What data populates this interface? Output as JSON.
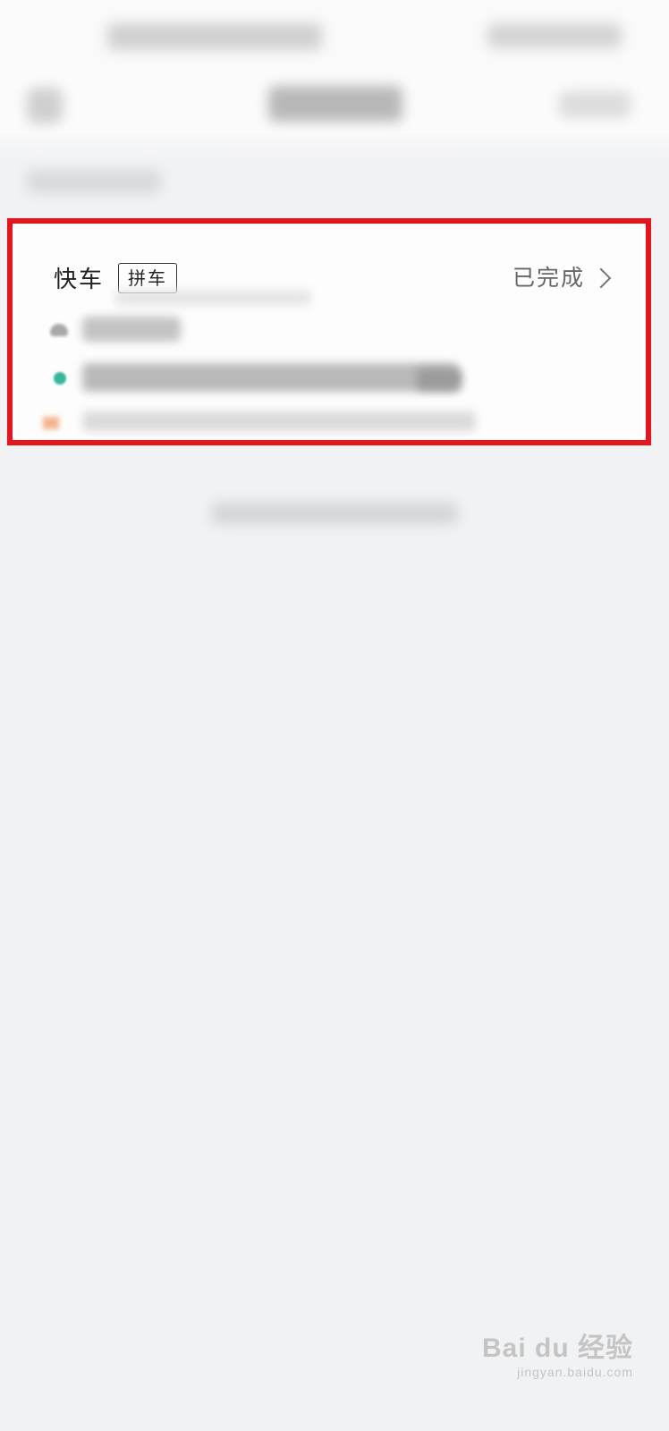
{
  "order_card": {
    "service_type": "快车",
    "ride_tag": "拼车",
    "status": "已完成"
  },
  "watermark": {
    "logo": "Bai du 经验",
    "sub": "jingyan.baidu.com"
  },
  "colors": {
    "highlight_border": "#e8141c",
    "pickup_dot": "#a8a8a8",
    "destination_dot": "#35b89a",
    "status_text": "#666666"
  }
}
